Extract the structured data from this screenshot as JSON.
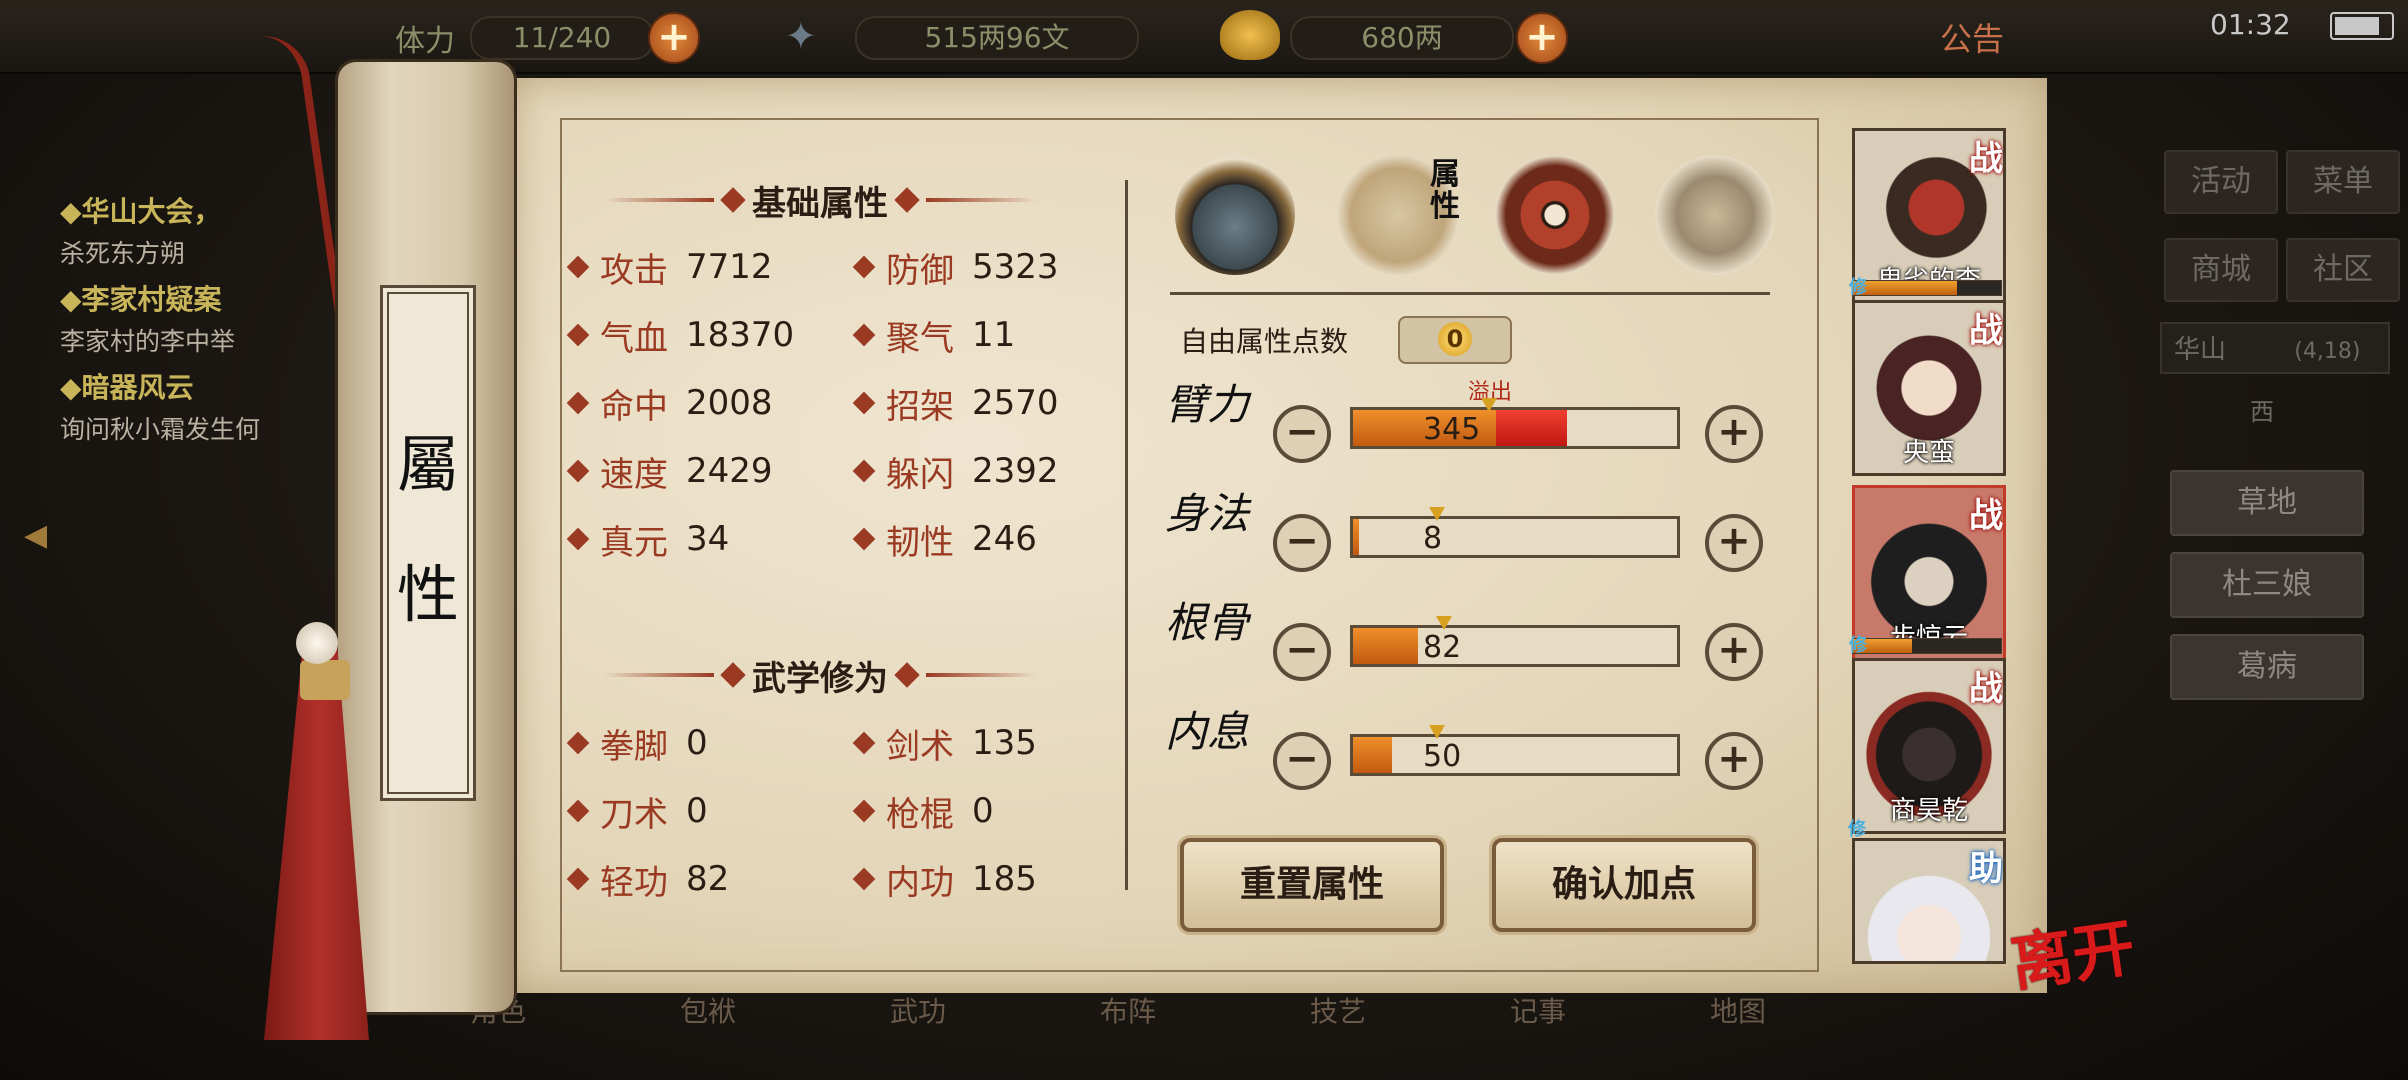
{
  "top_bar": {
    "stamina_label": "体力",
    "stamina_value": "11/240",
    "silver": "515两96文",
    "gold": "680两",
    "notice": "公告",
    "clock": "01:32"
  },
  "quests": [
    {
      "title": "◆华山大会，",
      "desc": "杀死东方朔"
    },
    {
      "title": "◆李家村疑案",
      "desc": "李家村的李中举"
    },
    {
      "title": "◆暗器风云",
      "desc": "询问秋小霜发生何"
    }
  ],
  "scroll_title": "屬\n性",
  "basic": {
    "header": "基础属性",
    "stats": [
      {
        "label": "攻击",
        "value": "7712"
      },
      {
        "label": "防御",
        "value": "5323"
      },
      {
        "label": "气血",
        "value": "18370"
      },
      {
        "label": "聚气",
        "value": "11"
      },
      {
        "label": "命中",
        "value": "2008"
      },
      {
        "label": "招架",
        "value": "2570"
      },
      {
        "label": "速度",
        "value": "2429"
      },
      {
        "label": "躲闪",
        "value": "2392"
      },
      {
        "label": "真元",
        "value": "34"
      },
      {
        "label": "韧性",
        "value": "246"
      }
    ]
  },
  "martial": {
    "header": "武学修为",
    "stats": [
      {
        "label": "拳脚",
        "value": "0"
      },
      {
        "label": "剑术",
        "value": "135"
      },
      {
        "label": "刀术",
        "value": "0"
      },
      {
        "label": "枪棍",
        "value": "0"
      },
      {
        "label": "轻功",
        "value": "82"
      },
      {
        "label": "内功",
        "value": "185"
      }
    ]
  },
  "tabs": {
    "attr_label": "属性"
  },
  "free_points": {
    "label": "自由属性点数",
    "value": "0"
  },
  "attributes": [
    {
      "name": "臂力",
      "value": "345",
      "fill": 0.44,
      "overflow": 0.22,
      "marker": 0.42,
      "overflow_label": "溢出"
    },
    {
      "name": "身法",
      "value": "8",
      "fill": 0.02,
      "overflow": 0,
      "marker": 0.26
    },
    {
      "name": "根骨",
      "value": "82",
      "fill": 0.2,
      "overflow": 0,
      "marker": 0.28
    },
    {
      "name": "内息",
      "value": "50",
      "fill": 0.12,
      "overflow": 0,
      "marker": 0.26
    }
  ],
  "buttons": {
    "reset": "重置属性",
    "confirm": "确认加点"
  },
  "party": [
    {
      "name": "卑劣的李",
      "tag": "战",
      "xp": 0.7,
      "xiu": "修"
    },
    {
      "name": "央蛮",
      "tag": "战"
    },
    {
      "name": "步惊云",
      "tag": "战",
      "xp": 0.4,
      "xiu": "修"
    },
    {
      "name": "商昊乾",
      "tag": "战",
      "xiu": "修"
    },
    {
      "name": "",
      "tag": "助"
    }
  ],
  "leave": "离开",
  "right_menu": {
    "buttons": [
      "活动",
      "菜单",
      "商城",
      "社区"
    ],
    "location": "华山",
    "coords": "(4,18)",
    "dirs": "西",
    "npcs": [
      "草地",
      "杜三娘",
      "葛病"
    ]
  },
  "bottom_nav": [
    "角色",
    "包袱",
    "武功",
    "布阵",
    "技艺",
    "记事",
    "地图"
  ],
  "colors": {
    "accent_red": "#9a3a22",
    "bar_orange": "#f08f2a",
    "bar_overflow": "#f04030",
    "paper": "#e8dcc2"
  }
}
